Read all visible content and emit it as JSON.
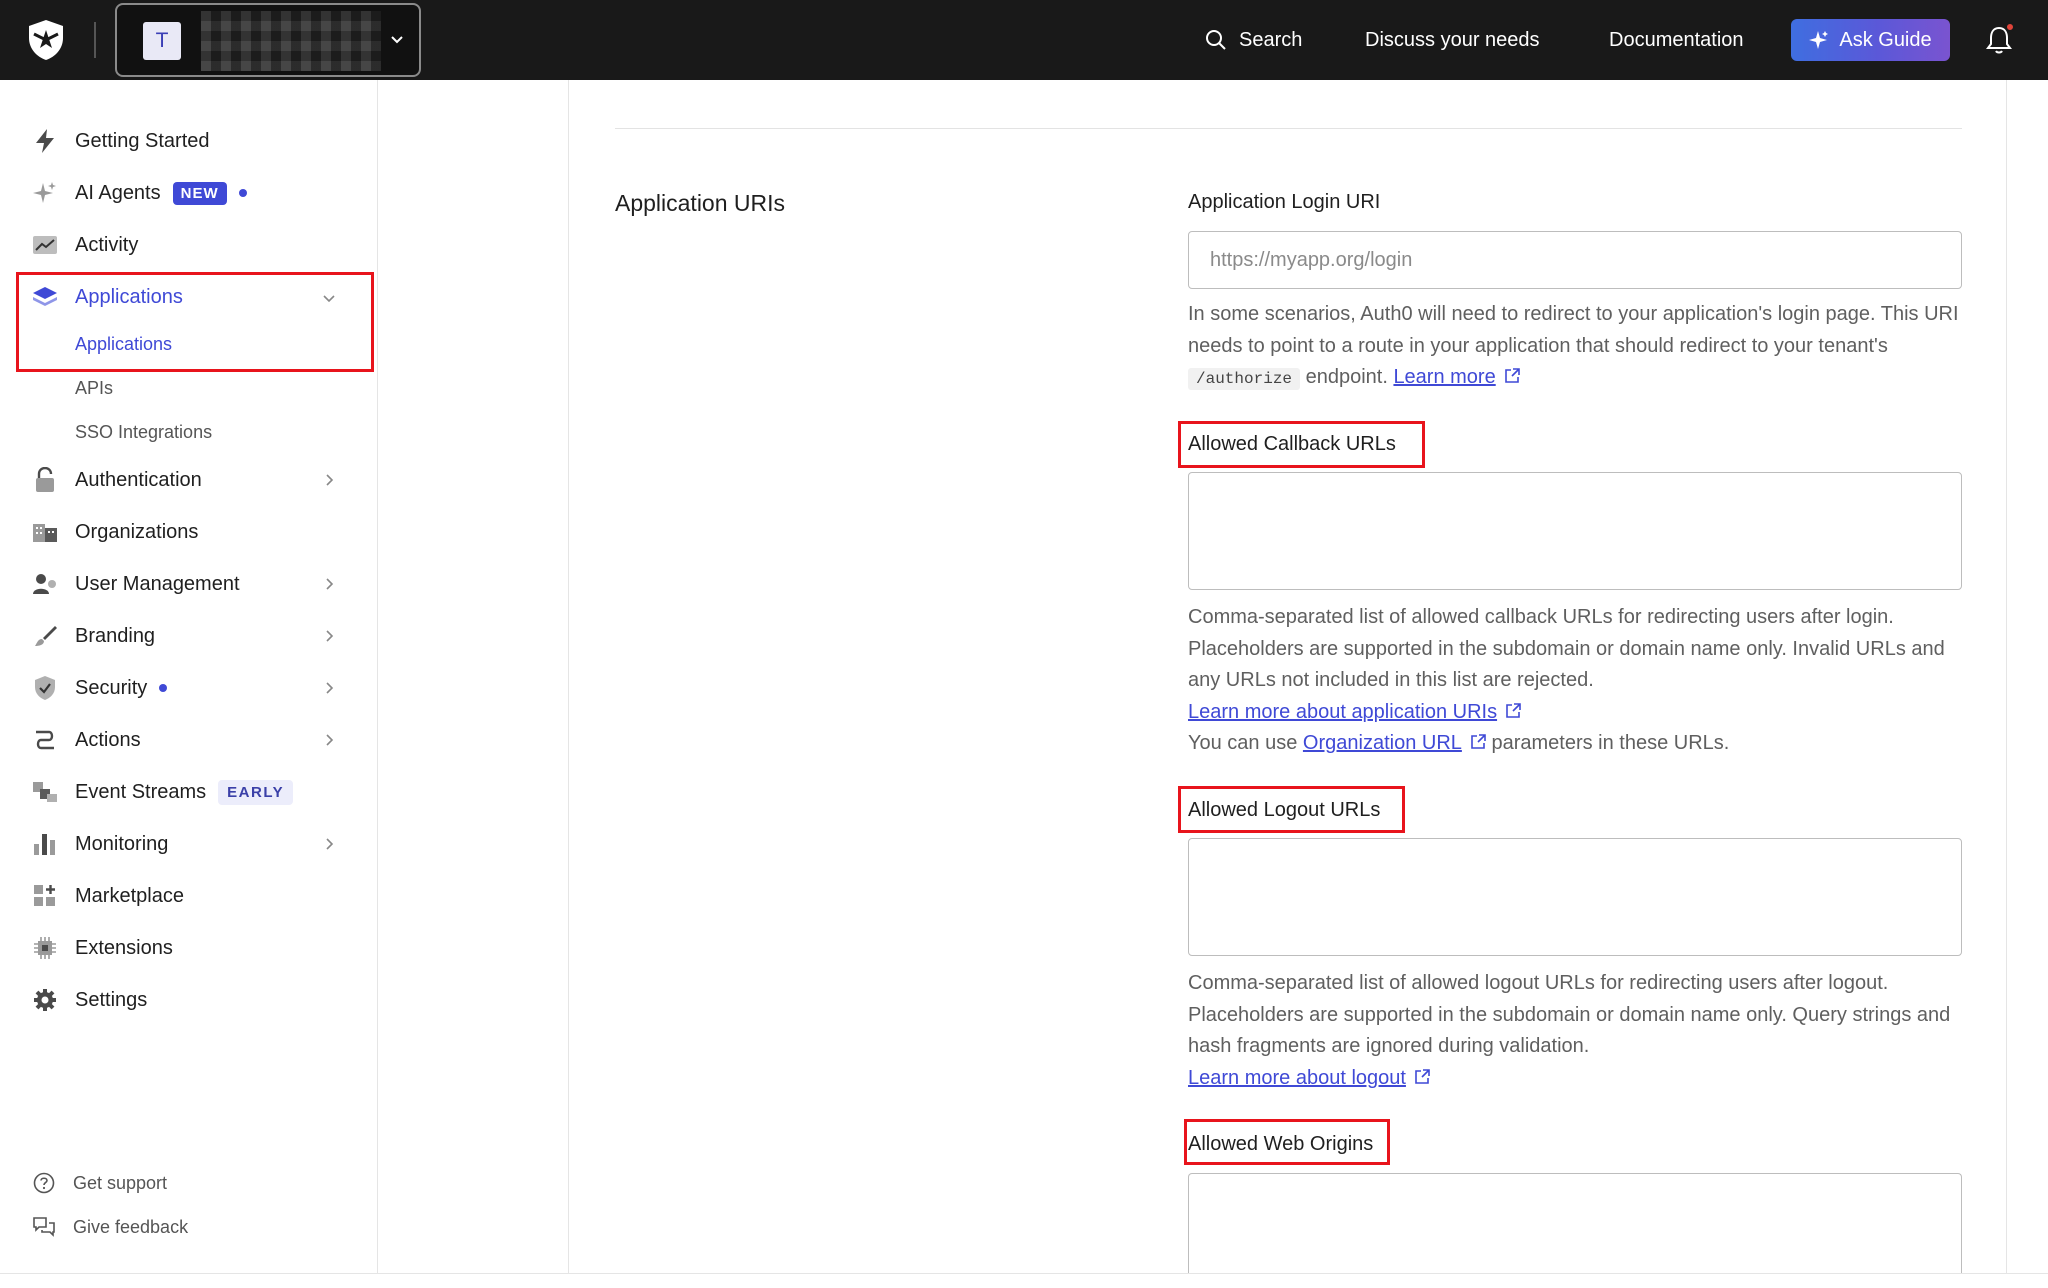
{
  "topbar": {
    "tenant_initial": "T",
    "search_label": "Search",
    "discuss_label": "Discuss your needs",
    "docs_label": "Documentation",
    "ask_guide_label": "Ask Guide"
  },
  "sidebar": {
    "items": [
      {
        "label": "Getting Started",
        "icon": "bolt-icon"
      },
      {
        "label": "AI Agents",
        "icon": "sparkle-icon",
        "badge": "NEW"
      },
      {
        "label": "Activity",
        "icon": "activity-chart-icon"
      },
      {
        "label": "Applications",
        "icon": "layers-icon",
        "active": true
      },
      {
        "label": "Authentication",
        "icon": "lock-icon"
      },
      {
        "label": "Organizations",
        "icon": "building-icon"
      },
      {
        "label": "User Management",
        "icon": "users-icon"
      },
      {
        "label": "Branding",
        "icon": "brush-icon"
      },
      {
        "label": "Security",
        "icon": "shield-check-icon"
      },
      {
        "label": "Actions",
        "icon": "flow-icon"
      },
      {
        "label": "Event Streams",
        "icon": "event-streams-icon",
        "badge": "EARLY"
      },
      {
        "label": "Monitoring",
        "icon": "bar-chart-icon"
      },
      {
        "label": "Marketplace",
        "icon": "grid-plus-icon"
      },
      {
        "label": "Extensions",
        "icon": "chip-icon"
      },
      {
        "label": "Settings",
        "icon": "gear-icon"
      }
    ],
    "sub_items": [
      "Applications",
      "APIs",
      "SSO Integrations"
    ],
    "footer": [
      {
        "label": "Get support",
        "icon": "help-circle-icon"
      },
      {
        "label": "Give feedback",
        "icon": "feedback-icon"
      }
    ]
  },
  "main": {
    "section_title": "Application URIs",
    "login_uri": {
      "label": "Application Login URI",
      "placeholder": "https://myapp.org/login",
      "value": "",
      "help_1": "In some scenarios, Auth0 will need to redirect to your application's login page. This URI needs to point to a route in your application that should redirect to your tenant's",
      "help_code": "/authorize",
      "help_2": "endpoint.",
      "learn_more": "Learn more"
    },
    "callback": {
      "label": "Allowed Callback URLs",
      "value": "",
      "help": "Comma-separated list of allowed callback URLs for redirecting users after login. Placeholders are supported in the subdomain or domain name only. Invalid URLs and any URLs not included in this list are rejected.",
      "learn_more": "Learn more about application URIs",
      "org_prefix": "You can use",
      "org_link": "Organization URL",
      "org_suffix": "parameters in these URLs."
    },
    "logout": {
      "label": "Allowed Logout URLs",
      "value": "",
      "help": "Comma-separated list of allowed logout URLs for redirecting users after logout. Placeholders are supported in the subdomain or domain name only. Query strings and hash fragments are ignored during validation.",
      "learn_more": "Learn more about logout"
    },
    "web_origins": {
      "label": "Allowed Web Origins",
      "value": ""
    }
  },
  "colors": {
    "accent": "#3f49d6",
    "highlight": "#e8141c",
    "topbar": "#191919"
  }
}
